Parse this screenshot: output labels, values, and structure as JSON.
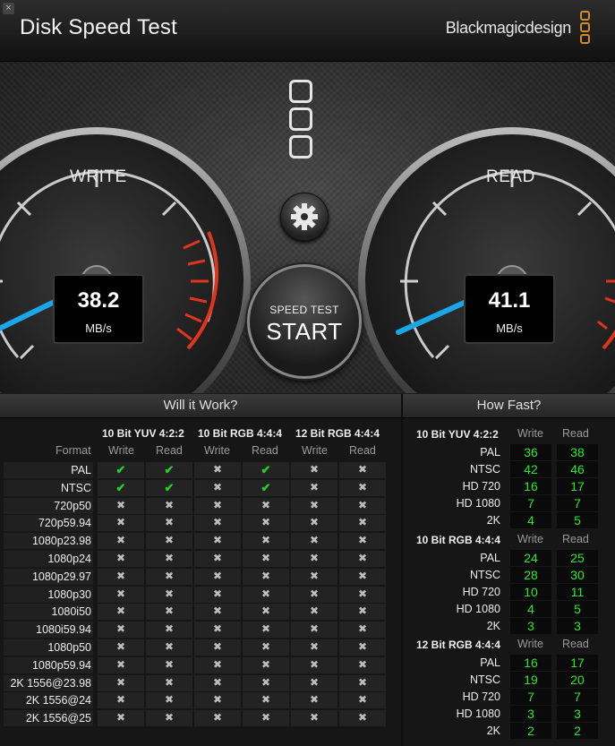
{
  "header": {
    "title": "Disk Speed Test",
    "brand": "Blackmagicdesign",
    "close_label": "×"
  },
  "write_gauge": {
    "label": "WRITE",
    "value": "38.2",
    "unit": "MB/s"
  },
  "read_gauge": {
    "label": "READ",
    "value": "41.1",
    "unit": "MB/s"
  },
  "start_button": {
    "line1": "SPEED TEST",
    "line2": "START"
  },
  "settings_icon": "gear-icon",
  "will_it_work": {
    "title": "Will it Work?",
    "groups": [
      "10 Bit YUV 4:2:2",
      "10 Bit RGB 4:4:4",
      "12 Bit RGB 4:4:4"
    ],
    "format_header": "Format",
    "write_label": "Write",
    "read_label": "Read",
    "rows": [
      {
        "format": "PAL",
        "marks": [
          "ok",
          "ok",
          "no",
          "ok",
          "no",
          "no"
        ]
      },
      {
        "format": "NTSC",
        "marks": [
          "ok",
          "ok",
          "no",
          "ok",
          "no",
          "no"
        ]
      },
      {
        "format": "720p50",
        "marks": [
          "no",
          "no",
          "no",
          "no",
          "no",
          "no"
        ]
      },
      {
        "format": "720p59.94",
        "marks": [
          "no",
          "no",
          "no",
          "no",
          "no",
          "no"
        ]
      },
      {
        "format": "1080p23.98",
        "marks": [
          "no",
          "no",
          "no",
          "no",
          "no",
          "no"
        ]
      },
      {
        "format": "1080p24",
        "marks": [
          "no",
          "no",
          "no",
          "no",
          "no",
          "no"
        ]
      },
      {
        "format": "1080p29.97",
        "marks": [
          "no",
          "no",
          "no",
          "no",
          "no",
          "no"
        ]
      },
      {
        "format": "1080p30",
        "marks": [
          "no",
          "no",
          "no",
          "no",
          "no",
          "no"
        ]
      },
      {
        "format": "1080i50",
        "marks": [
          "no",
          "no",
          "no",
          "no",
          "no",
          "no"
        ]
      },
      {
        "format": "1080i59.94",
        "marks": [
          "no",
          "no",
          "no",
          "no",
          "no",
          "no"
        ]
      },
      {
        "format": "1080p50",
        "marks": [
          "no",
          "no",
          "no",
          "no",
          "no",
          "no"
        ]
      },
      {
        "format": "1080p59.94",
        "marks": [
          "no",
          "no",
          "no",
          "no",
          "no",
          "no"
        ]
      },
      {
        "format": "2K 1556@23.98",
        "marks": [
          "no",
          "no",
          "no",
          "no",
          "no",
          "no"
        ]
      },
      {
        "format": "2K 1556@24",
        "marks": [
          "no",
          "no",
          "no",
          "no",
          "no",
          "no"
        ]
      },
      {
        "format": "2K 1556@25",
        "marks": [
          "no",
          "no",
          "no",
          "no",
          "no",
          "no"
        ]
      }
    ]
  },
  "how_fast": {
    "title": "How Fast?",
    "write_label": "Write",
    "read_label": "Read",
    "groups": [
      {
        "name": "10 Bit YUV 4:2:2",
        "rows": [
          {
            "format": "PAL",
            "write": "36",
            "read": "38"
          },
          {
            "format": "NTSC",
            "write": "42",
            "read": "46"
          },
          {
            "format": "HD 720",
            "write": "16",
            "read": "17"
          },
          {
            "format": "HD 1080",
            "write": "7",
            "read": "7"
          },
          {
            "format": "2K",
            "write": "4",
            "read": "5"
          }
        ]
      },
      {
        "name": "10 Bit RGB 4:4:4",
        "rows": [
          {
            "format": "PAL",
            "write": "24",
            "read": "25"
          },
          {
            "format": "NTSC",
            "write": "28",
            "read": "30"
          },
          {
            "format": "HD 720",
            "write": "10",
            "read": "11"
          },
          {
            "format": "HD 1080",
            "write": "4",
            "read": "5"
          },
          {
            "format": "2K",
            "write": "3",
            "read": "3"
          }
        ]
      },
      {
        "name": "12 Bit RGB 4:4:4",
        "rows": [
          {
            "format": "PAL",
            "write": "16",
            "read": "17"
          },
          {
            "format": "NTSC",
            "write": "19",
            "read": "20"
          },
          {
            "format": "HD 720",
            "write": "7",
            "read": "7"
          },
          {
            "format": "HD 1080",
            "write": "3",
            "read": "3"
          },
          {
            "format": "2K",
            "write": "2",
            "read": "2"
          }
        ]
      }
    ]
  },
  "colors": {
    "accent": "#d6892a",
    "needle": "#1aa7e8",
    "ok": "#27d027",
    "number": "#2ce82c",
    "redzone": "#e0351d"
  }
}
